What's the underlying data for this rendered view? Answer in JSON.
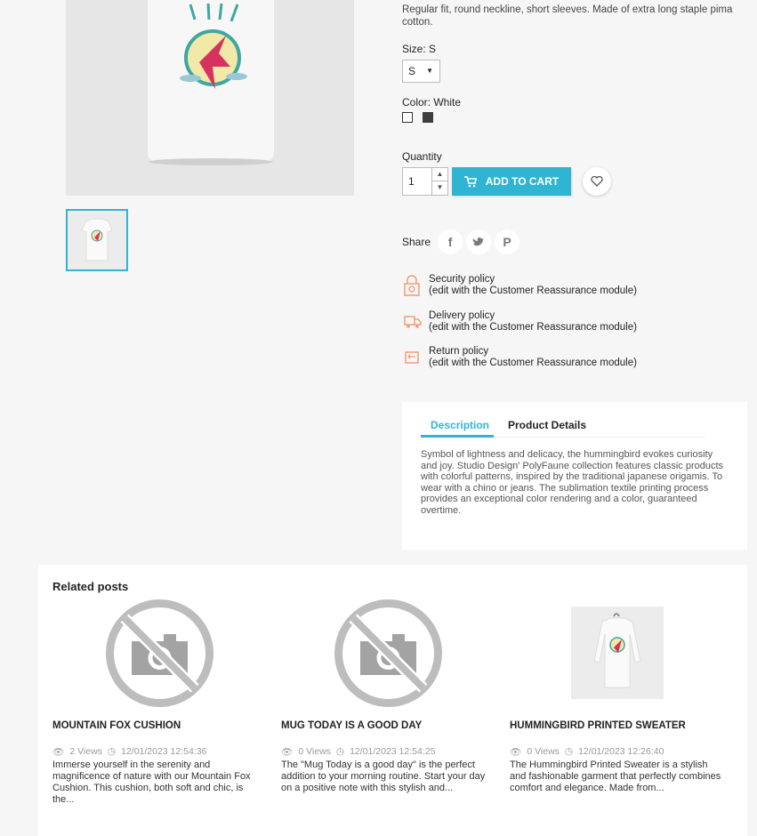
{
  "product": {
    "short_description": "Regular fit, round neckline, short sleeves. Made of extra long staple pima cotton.",
    "size_label": "Size: S",
    "size_value": "S",
    "color_label": "Color: White",
    "colors": [
      "#ffffff",
      "#3e3e3e"
    ],
    "quantity_label": "Quantity",
    "quantity_value": "1",
    "add_to_cart": "ADD TO CART",
    "share_label": "Share",
    "share_icons": [
      "facebook-icon",
      "twitter-icon",
      "pinterest-icon"
    ]
  },
  "reassurance": [
    {
      "title": "Security policy",
      "sub": "(edit with the Customer Reassurance module)"
    },
    {
      "title": "Delivery policy",
      "sub": "(edit with the Customer Reassurance module)"
    },
    {
      "title": "Return policy",
      "sub": "(edit with the Customer Reassurance module)"
    }
  ],
  "tabs": {
    "items": [
      "Description",
      "Product Details"
    ],
    "active": "Description",
    "body": "Symbol of lightness and delicacy, the hummingbird evokes curiosity and joy. Studio Design' PolyFaune collection features classic products with colorful patterns, inspired by the traditional japanese origamis. To wear with a chino or jeans. The sublimation textile printing process provides an exceptional color rendering and a color, guaranteed overtime."
  },
  "related": {
    "heading": "Related posts",
    "posts": [
      {
        "title": "MOUNTAIN FOX CUSHION",
        "views": "2 Views",
        "date": "12/01/2023 12:54:36",
        "excerpt": "Immerse yourself in the serenity and magnificence of nature with our Mountain Fox Cushion. This cushion, both soft and chic, is the..."
      },
      {
        "title": "MUG TODAY IS A GOOD DAY",
        "views": "0 Views",
        "date": "12/01/2023 12:54:25",
        "excerpt": "The \"Mug Today is a good day\" is the perfect addition to your morning routine. Start your day on a positive note with this stylish and..."
      },
      {
        "title": "HUMMINGBIRD PRINTED SWEATER",
        "views": "0 Views",
        "date": "12/01/2023 12:26:40",
        "excerpt": "The Hummingbird Printed Sweater is a stylish and fashionable garment that perfectly combines comfort and elegance. Made from..."
      }
    ]
  },
  "accent_color": "#2fb5d2"
}
